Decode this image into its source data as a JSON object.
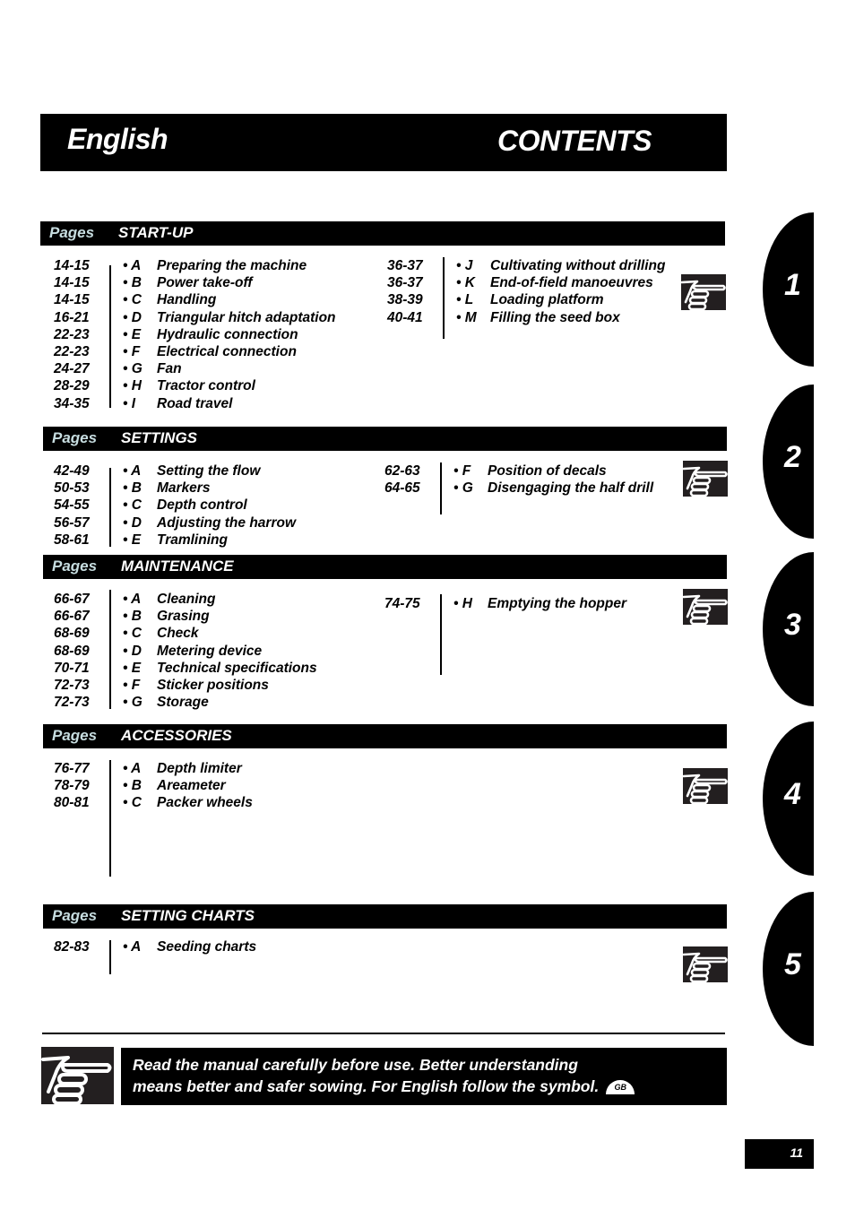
{
  "header": {
    "language": "English",
    "title": "CONTENTS"
  },
  "pages_label": "Pages",
  "sections": [
    {
      "title": "START-UP",
      "left": [
        {
          "pages": "14-15",
          "letter": "• A",
          "label": "Preparing the machine"
        },
        {
          "pages": "14-15",
          "letter": "• B",
          "label": "Power take-off"
        },
        {
          "pages": "14-15",
          "letter": "• C",
          "label": "Handling"
        },
        {
          "pages": "16-21",
          "letter": "• D",
          "label": "Triangular hitch adaptation"
        },
        {
          "pages": "22-23",
          "letter": "• E",
          "label": "Hydraulic connection"
        },
        {
          "pages": "22-23",
          "letter": "• F",
          "label": "Electrical connection"
        },
        {
          "pages": "24-27",
          "letter": "• G",
          "label": "Fan"
        },
        {
          "pages": "28-29",
          "letter": "• H",
          "label": "Tractor control"
        },
        {
          "pages": "34-35",
          "letter": "• I",
          "label": "Road travel"
        }
      ],
      "right": [
        {
          "pages": "36-37",
          "letter": "• J",
          "label": "Cultivating without drilling"
        },
        {
          "pages": "36-37",
          "letter": "• K",
          "label": "End-of-field manoeuvres"
        },
        {
          "pages": "38-39",
          "letter": "• L",
          "label": "Loading platform"
        },
        {
          "pages": "40-41",
          "letter": "• M",
          "label": "Filling the seed box"
        }
      ]
    },
    {
      "title": "SETTINGS",
      "left": [
        {
          "pages": "42-49",
          "letter": "• A",
          "label": "Setting the flow"
        },
        {
          "pages": "50-53",
          "letter": "• B",
          "label": "Markers"
        },
        {
          "pages": "54-55",
          "letter": "• C",
          "label": "Depth control"
        },
        {
          "pages": "56-57",
          "letter": "• D",
          "label": "Adjusting the harrow"
        },
        {
          "pages": "58-61",
          "letter": "• E",
          "label": "Tramlining"
        }
      ],
      "right": [
        {
          "pages": "62-63",
          "letter": "• F",
          "label": "Position of decals"
        },
        {
          "pages": "64-65",
          "letter": "• G",
          "label": "Disengaging the half drill"
        }
      ]
    },
    {
      "title": "MAINTENANCE",
      "left": [
        {
          "pages": "66-67",
          "letter": "• A",
          "label": "Cleaning"
        },
        {
          "pages": "66-67",
          "letter": "• B",
          "label": "Grasing"
        },
        {
          "pages": "68-69",
          "letter": "• C",
          "label": "Check"
        },
        {
          "pages": "68-69",
          "letter": "• D",
          "label": "Metering device"
        },
        {
          "pages": "70-71",
          "letter": "• E",
          "label": "Technical specifications"
        },
        {
          "pages": "72-73",
          "letter": "• F",
          "label": "Sticker positions"
        },
        {
          "pages": "72-73",
          "letter": "• G",
          "label": "Storage"
        }
      ],
      "right": [
        {
          "pages": "74-75",
          "letter": "• H",
          "label": "Emptying the hopper"
        }
      ]
    },
    {
      "title": "ACCESSORIES",
      "left": [
        {
          "pages": "76-77",
          "letter": "• A",
          "label": "Depth limiter"
        },
        {
          "pages": "78-79",
          "letter": "• B",
          "label": "Areameter"
        },
        {
          "pages": "80-81",
          "letter": "• C",
          "label": "Packer wheels"
        }
      ],
      "right": []
    },
    {
      "title": "SETTING CHARTS",
      "left": [
        {
          "pages": "82-83",
          "letter": "• A",
          "label": "Seeding charts"
        }
      ],
      "right": []
    }
  ],
  "side_tabs": [
    "1",
    "2",
    "3",
    "4",
    "5"
  ],
  "note": {
    "line1": "Read  the manual carefully before use. Better understanding",
    "line2": "means better and safer sowing. For English follow the symbol.",
    "badge": "GB",
    "icon": "pointing-hand-icon"
  },
  "page_number": "11"
}
